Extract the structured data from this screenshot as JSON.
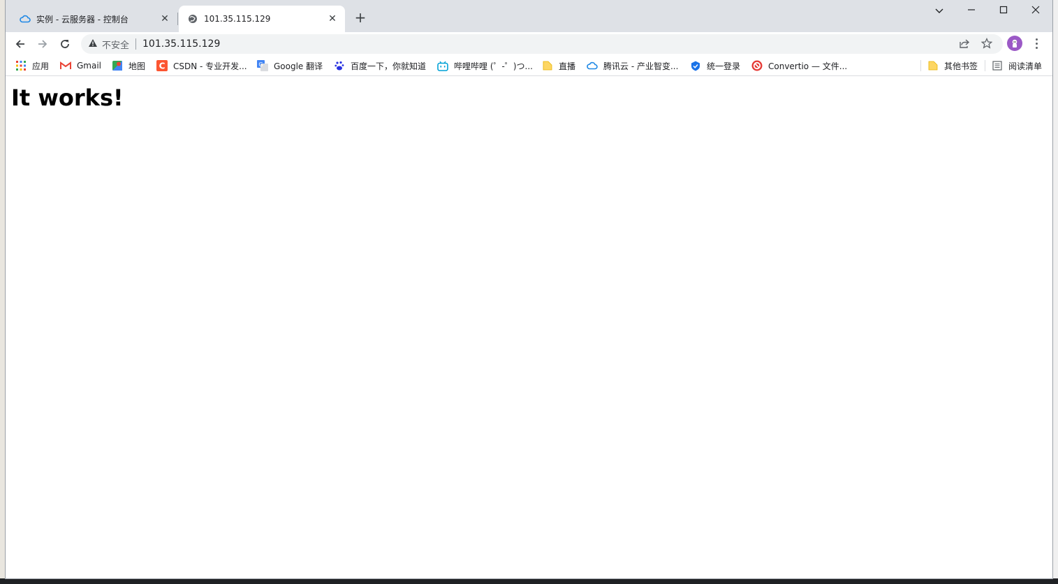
{
  "tabs": [
    {
      "title": "实例 - 云服务器 - 控制台",
      "icon": "cloud-icon",
      "active": false
    },
    {
      "title": "101.35.115.129",
      "icon": "globe-icon",
      "active": true
    }
  ],
  "omnibox": {
    "security_label": "不安全",
    "url": "101.35.115.129"
  },
  "bookmarks": [
    {
      "label": "应用",
      "icon": "apps-grid-icon"
    },
    {
      "label": "Gmail",
      "icon": "gmail-icon"
    },
    {
      "label": "地图",
      "icon": "maps-icon"
    },
    {
      "label": "CSDN - 专业开发...",
      "icon": "csdn-icon"
    },
    {
      "label": "Google 翻译",
      "icon": "translate-icon"
    },
    {
      "label": "百度一下，你就知道",
      "icon": "baidu-icon"
    },
    {
      "label": "哔哩哔哩 (゜-゜)つ...",
      "icon": "bilibili-icon"
    },
    {
      "label": "直播",
      "icon": "folder-icon"
    },
    {
      "label": "腾讯云 - 产业智变...",
      "icon": "cloud-icon"
    },
    {
      "label": "统一登录",
      "icon": "shield-icon"
    },
    {
      "label": "Convertio — 文件...",
      "icon": "convertio-icon"
    }
  ],
  "bookmarks_right": {
    "other": "其他书签",
    "reading_list": "阅读清单"
  },
  "page": {
    "heading": "It works!"
  },
  "colors": {
    "titlebar": "#dee1e6",
    "omnibox": "#f1f3f4",
    "tencent_blue": "#1e88e5",
    "avatar": "#9b59c6"
  }
}
